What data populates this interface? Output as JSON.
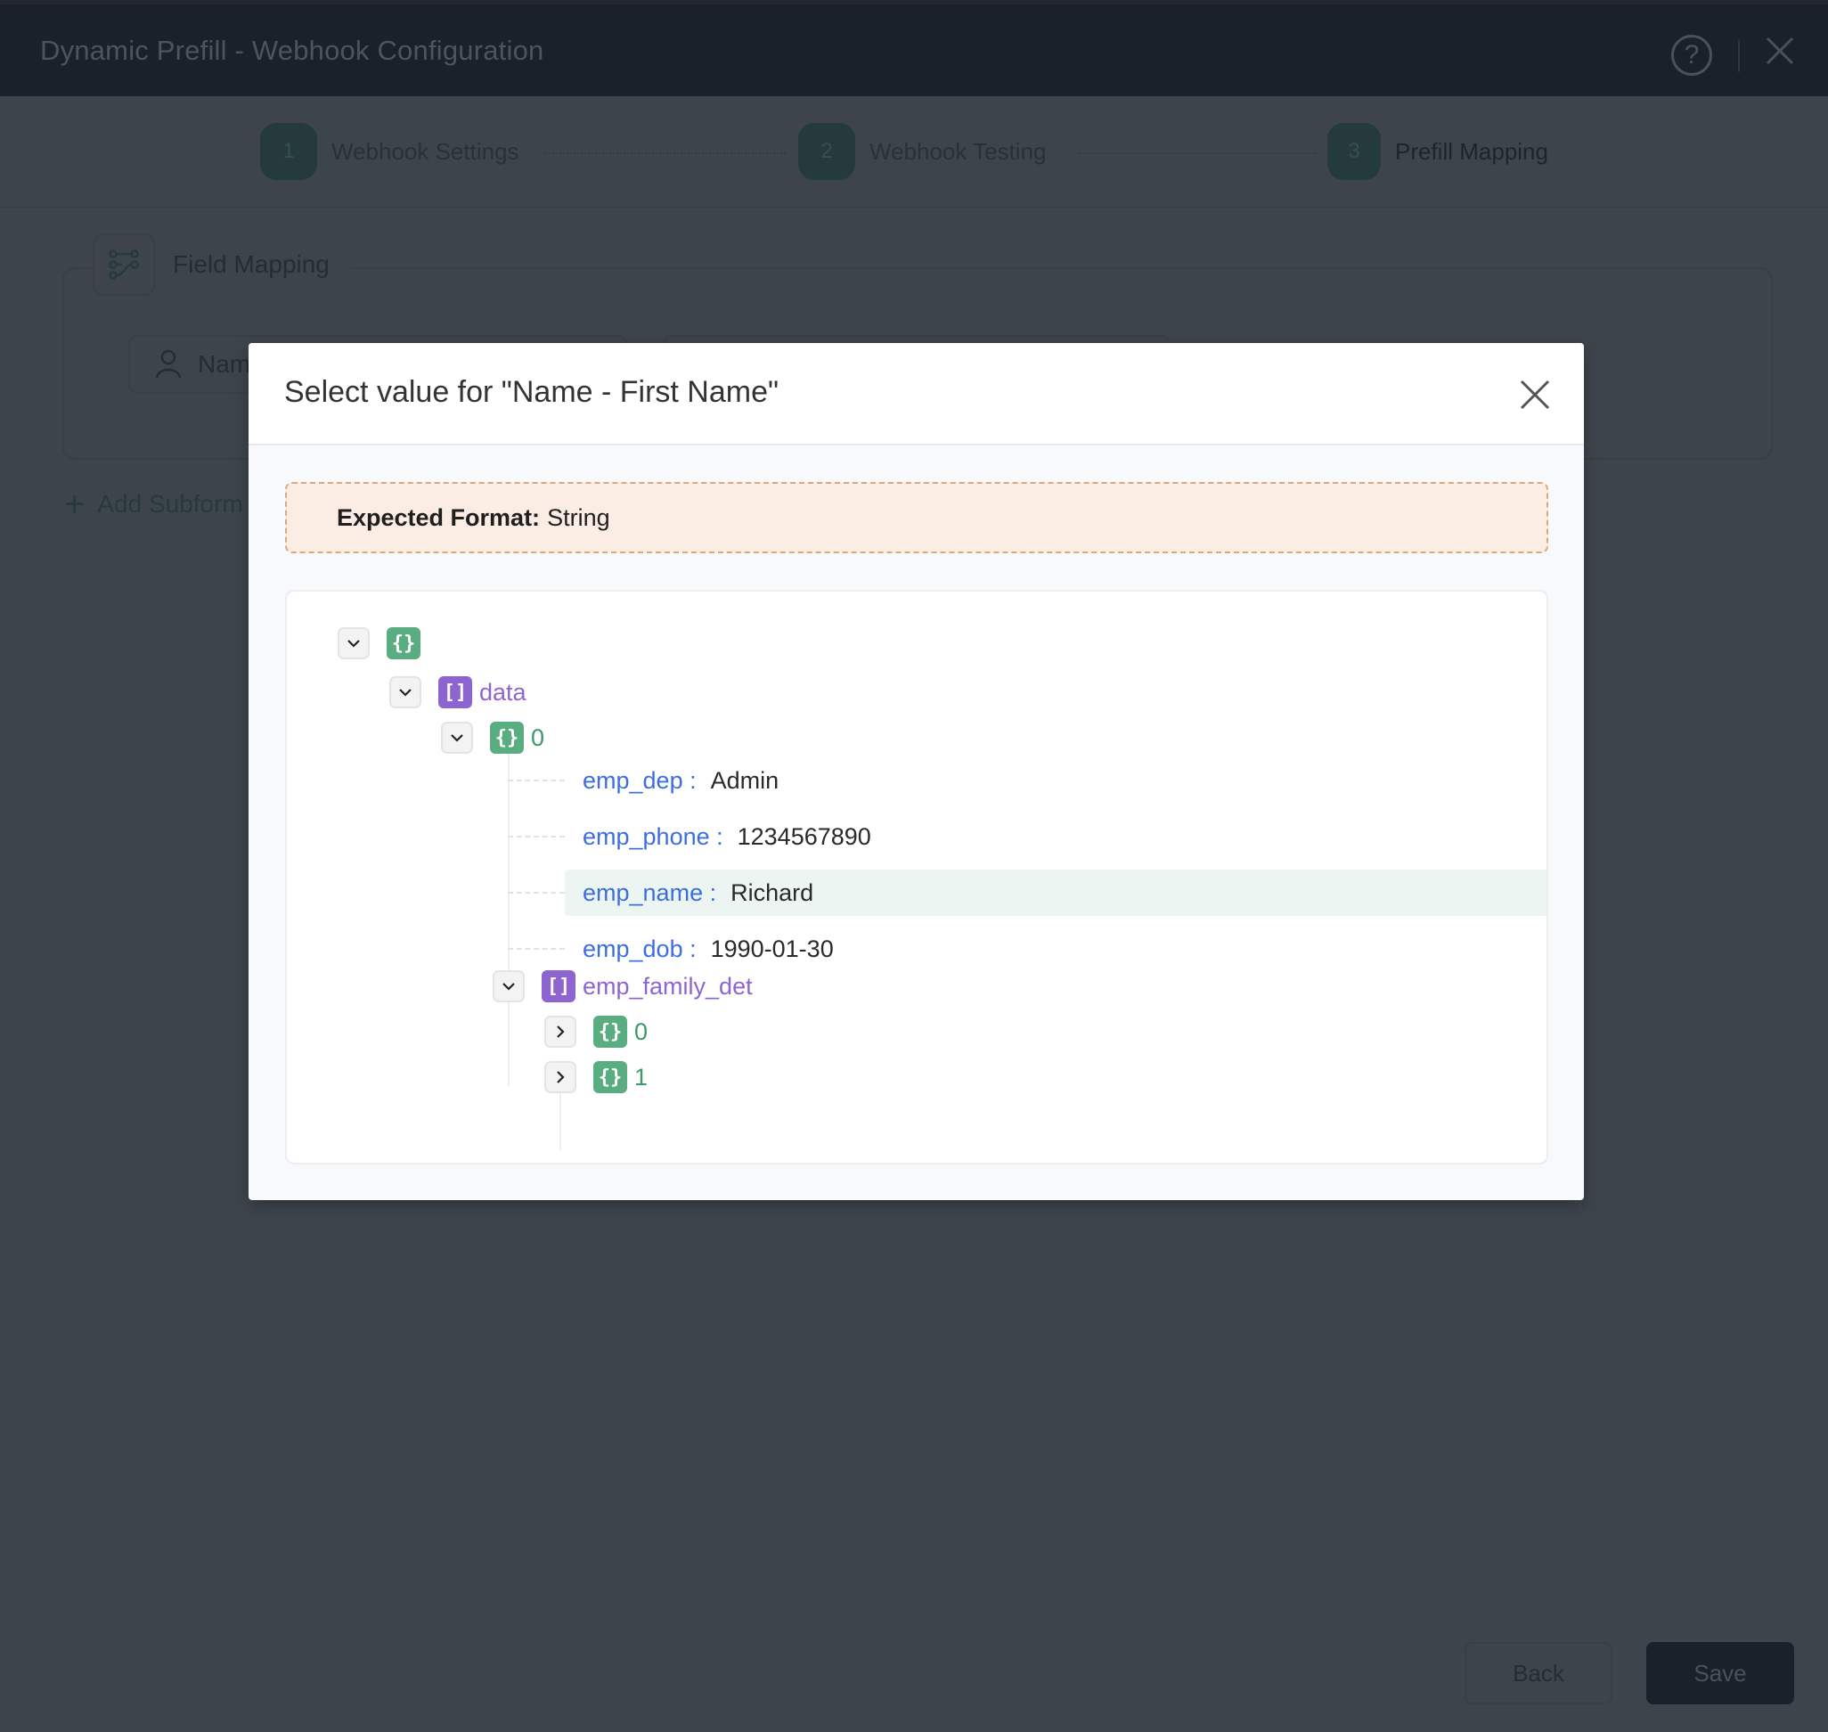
{
  "window": {
    "title": "Dynamic Prefill - Webhook Configuration",
    "help_icon": "help-circle-icon",
    "close_icon": "close-icon"
  },
  "stepper": {
    "steps": [
      {
        "number": "1",
        "label": "Webhook Settings"
      },
      {
        "number": "2",
        "label": "Webhook Testing"
      },
      {
        "number": "3",
        "label": "Prefill Mapping",
        "active": true
      }
    ]
  },
  "field_mapping": {
    "legend": "Field Mapping",
    "legend_icon": "mapping-icon",
    "field_label": "Nam",
    "field_icon": "user-icon",
    "add_subform_label": "Add Subform"
  },
  "footer": {
    "back_label": "Back",
    "save_label": "Save"
  },
  "modal": {
    "title": "Select value for \"Name - First Name\"",
    "expected_format_label": "Expected Format:",
    "expected_format_value": "String",
    "tree": {
      "root_badge": "{}",
      "data_label": "data",
      "data_badge": "[]",
      "item0_label": "0",
      "item0_badge": "{}",
      "fields": [
        {
          "key": "emp_dep :",
          "value": "Admin"
        },
        {
          "key": "emp_phone :",
          "value": "1234567890"
        },
        {
          "key": "emp_name :",
          "value": "Richard",
          "selected": true
        },
        {
          "key": "emp_dob :",
          "value": "1990-01-30"
        }
      ],
      "family_label": "emp_family_det",
      "family_badge": "[]",
      "family_items": [
        {
          "label": "0",
          "badge": "{}"
        },
        {
          "label": "1",
          "badge": "{}"
        }
      ]
    }
  },
  "colors": {
    "object_badge": "#5aad80",
    "array_badge": "#8e65d0",
    "key_text": "#3c6fde",
    "selected_row": "#ecf5f1",
    "format_box_bg": "#fbede3",
    "format_box_border": "#d8a882"
  }
}
